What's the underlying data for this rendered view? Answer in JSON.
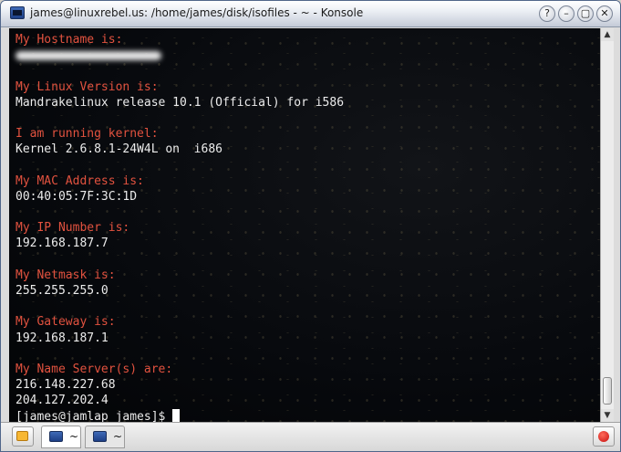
{
  "window": {
    "title": "james@linuxrebel.us: /home/james/disk/isofiles - ~ - Konsole",
    "buttons": {
      "help": "?",
      "minimize": "–",
      "maximize": "▢",
      "close": "✕"
    }
  },
  "terminal": {
    "lines": [
      {
        "kind": "label",
        "text": "My Hostname is:"
      },
      {
        "kind": "redacted",
        "text": ""
      },
      {
        "kind": "blank",
        "text": ""
      },
      {
        "kind": "label",
        "text": "My Linux Version is:"
      },
      {
        "kind": "value",
        "text": "Mandrakelinux release 10.1 (Official) for i586"
      },
      {
        "kind": "blank",
        "text": ""
      },
      {
        "kind": "label",
        "text": "I am running kernel:"
      },
      {
        "kind": "value",
        "text": "Kernel 2.6.8.1-24W4L on  i686"
      },
      {
        "kind": "blank",
        "text": ""
      },
      {
        "kind": "label",
        "text": "My MAC Address is:"
      },
      {
        "kind": "value",
        "text": "00:40:05:7F:3C:1D"
      },
      {
        "kind": "blank",
        "text": ""
      },
      {
        "kind": "label",
        "text": "My IP Number is:"
      },
      {
        "kind": "value",
        "text": "192.168.187.7"
      },
      {
        "kind": "blank",
        "text": ""
      },
      {
        "kind": "label",
        "text": "My Netmask is:"
      },
      {
        "kind": "value",
        "text": "255.255.255.0"
      },
      {
        "kind": "blank",
        "text": ""
      },
      {
        "kind": "label",
        "text": "My Gateway is:"
      },
      {
        "kind": "value",
        "text": "192.168.187.1"
      },
      {
        "kind": "blank",
        "text": ""
      },
      {
        "kind": "label",
        "text": "My Name Server(s) are:"
      },
      {
        "kind": "value",
        "text": "216.148.227.68"
      },
      {
        "kind": "value",
        "text": "204.127.202.4"
      }
    ],
    "prompt": "[james@jamlap james]$ ",
    "colors": {
      "label": "#e2523f",
      "value": "#ececec",
      "background": "#07090d"
    }
  },
  "scrollbar": {
    "up_icon": "scroll-up-arrow",
    "down_icon": "scroll-down-arrow",
    "position_fraction": 1.0
  },
  "tabbar": {
    "tabs": [
      {
        "label": "~",
        "active": true
      },
      {
        "label": "~",
        "active": false
      }
    ],
    "new_tab_icon": "new-session-icon",
    "close_tab_icon": "close-session-icon"
  }
}
